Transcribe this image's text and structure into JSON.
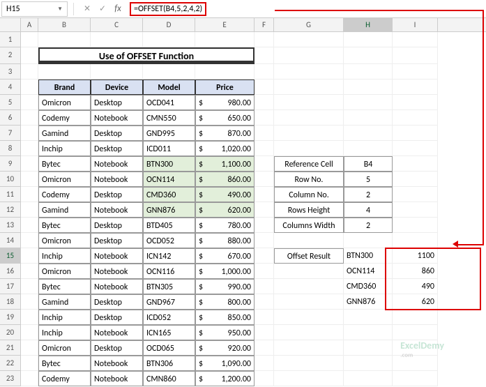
{
  "nameBox": "H15",
  "formula": "=OFFSET(B4,5,2,4,2)",
  "columns": [
    "A",
    "B",
    "C",
    "D",
    "E",
    "F",
    "G",
    "H",
    "I"
  ],
  "rows": [
    1,
    2,
    3,
    4,
    5,
    6,
    7,
    8,
    9,
    10,
    11,
    12,
    13,
    14,
    15,
    16,
    17,
    18,
    19,
    20,
    21,
    22,
    23
  ],
  "title": "Use of OFFSET Function",
  "headers": {
    "brand": "Brand",
    "device": "Device",
    "model": "Model",
    "price": "Price"
  },
  "currency": "$",
  "chart_data": {
    "type": "table",
    "title": "Use of OFFSET Function",
    "columns": [
      "Brand",
      "Device",
      "Model",
      "Price"
    ],
    "rows": [
      {
        "brand": "Omicron",
        "device": "Desktop",
        "model": "OCD041",
        "price": "980.00",
        "hl": false
      },
      {
        "brand": "Codemy",
        "device": "Notebook",
        "model": "CMN550",
        "price": "650.00",
        "hl": false
      },
      {
        "brand": "Gamind",
        "device": "Desktop",
        "model": "GND995",
        "price": "870.00",
        "hl": false
      },
      {
        "brand": "Inchip",
        "device": "Desktop",
        "model": "ICD011",
        "price": "1,020.00",
        "hl": false
      },
      {
        "brand": "Bytec",
        "device": "Notebook",
        "model": "BTN300",
        "price": "1,100.00",
        "hl": true
      },
      {
        "brand": "Omicron",
        "device": "Notebook",
        "model": "OCN114",
        "price": "860.00",
        "hl": true
      },
      {
        "brand": "Codemy",
        "device": "Desktop",
        "model": "CMD360",
        "price": "490.00",
        "hl": true
      },
      {
        "brand": "Gamind",
        "device": "Notebook",
        "model": "GNN876",
        "price": "620.00",
        "hl": true
      },
      {
        "brand": "Bytec",
        "device": "Desktop",
        "model": "BTD405",
        "price": "780.00",
        "hl": false
      },
      {
        "brand": "Omicron",
        "device": "Desktop",
        "model": "OCD052",
        "price": "880.00",
        "hl": false
      },
      {
        "brand": "Inchip",
        "device": "Notebook",
        "model": "ICN142",
        "price": "670.00",
        "hl": false
      },
      {
        "brand": "Omicron",
        "device": "Notebook",
        "model": "OCN116",
        "price": "1,000.00",
        "hl": false
      },
      {
        "brand": "Bytec",
        "device": "Notebook",
        "model": "BTN305",
        "price": "990.00",
        "hl": false
      },
      {
        "brand": "Gamind",
        "device": "Desktop",
        "model": "GND967",
        "price": "800.00",
        "hl": false
      },
      {
        "brand": "Inchip",
        "device": "Desktop",
        "model": "ICD052",
        "price": "850.00",
        "hl": false
      },
      {
        "brand": "Inchip",
        "device": "Notebook",
        "model": "ICN165",
        "price": "950.00",
        "hl": false
      },
      {
        "brand": "Omicron",
        "device": "Desktop",
        "model": "OCD065",
        "price": "920.00",
        "hl": false
      },
      {
        "brand": "Bytec",
        "device": "Notebook",
        "model": "BTN306",
        "price": "1,090.00",
        "hl": false
      },
      {
        "brand": "Codemy",
        "device": "Notebook",
        "model": "CMN860",
        "price": "1,200.00",
        "hl": false
      }
    ]
  },
  "ref": [
    {
      "label": "Reference Cell",
      "val": "B4"
    },
    {
      "label": "Row No.",
      "val": "5"
    },
    {
      "label": "Column No.",
      "val": "2"
    },
    {
      "label": "Rows Height",
      "val": "4"
    },
    {
      "label": "Columns Width",
      "val": "2"
    }
  ],
  "resultLabel": "Offset Result",
  "results": [
    {
      "model": "BTN300",
      "price": "1100"
    },
    {
      "model": "OCN114",
      "price": "860"
    },
    {
      "model": "CMD360",
      "price": "490"
    },
    {
      "model": "GNN876",
      "price": "620"
    }
  ],
  "watermark": {
    "main": "ExcelDemy",
    "sub": ".com"
  }
}
